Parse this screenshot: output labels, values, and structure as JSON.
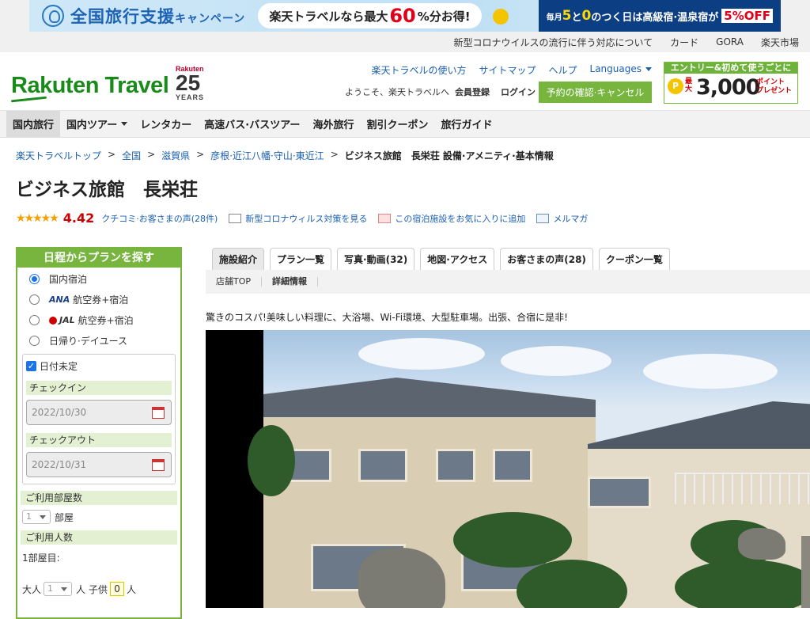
{
  "banner": {
    "title": "全国旅行支援",
    "title_suffix": "キャンペーン",
    "pill_prefix": "楽天トラベルなら最大",
    "pill_big": "60",
    "pill_suffix": "%分お得!",
    "right_prefix": "毎月",
    "right_5": "5",
    "right_mid": "と",
    "right_0": "0",
    "right_text": "のつく日は高級宿·温泉宿が",
    "right_pct": "5%OFF"
  },
  "top_links": [
    "新型コロナウイルスの流行に伴う対応について",
    "カード",
    "GORA",
    "楽天市場"
  ],
  "header": {
    "logo": "Rakuten Travel",
    "anniv_brand": "Rakuten",
    "anniv_num": "25",
    "anniv_years": "YEARS",
    "links": [
      "楽天トラベルの使い方",
      "サイトマップ",
      "ヘルプ"
    ],
    "languages": "Languages",
    "welcome": "ようこそ、楽天トラベルへ",
    "member": "会員登録",
    "login": "ログイン",
    "reserve": "予約の確認·キャンセル",
    "promo_top": "エントリー&初めて使うごとに",
    "promo_coin": "P",
    "promo_pre": "最大",
    "promo_amount": "3,000",
    "promo_pt1": "ポイント",
    "promo_pt2": "プレゼント"
  },
  "nav": [
    "国内旅行",
    "国内ツアー",
    "レンタカー",
    "高速バス·バスツアー",
    "海外旅行",
    "割引クーポン",
    "旅行ガイド"
  ],
  "breadcrumb": [
    "楽天トラベルトップ",
    "全国",
    "滋賀県",
    "彦根·近江八幡·守山·東近江"
  ],
  "breadcrumb_current": "ビジネス旅館　長栄荘 設備·アメニティ·基本情報",
  "hotel_title": "ビジネス旅館　長栄荘",
  "rating": {
    "stars": "★★★★★",
    "score": "4.42",
    "reviews": "クチコミ·お客さまの声(28件)",
    "covid": "新型コロナウィルス対策を見る",
    "favorite": "この宿泊施設をお気に入りに追加",
    "mail": "メルマガ"
  },
  "sidebar": {
    "title": "日程からプランを探す",
    "options": [
      {
        "label": "国内宿泊",
        "airline": ""
      },
      {
        "label": "航空券+宿泊",
        "airline": "ANA"
      },
      {
        "label": "航空券+宿泊",
        "airline": "JAL"
      },
      {
        "label": "日帰り·デイユース",
        "airline": ""
      }
    ],
    "date_undecided": "日付未定",
    "checkin_label": "チェックイン",
    "checkin_value": "2022/10/30",
    "checkout_label": "チェックアウト",
    "checkout_value": "2022/10/31",
    "rooms_label": "ご利用部屋数",
    "rooms_value": "1",
    "rooms_unit": "部屋",
    "guests_label": "ご利用人数",
    "room1": "1部屋目:",
    "adult_label": "大人",
    "adult_value": "1",
    "person": "人",
    "child_label": "子供",
    "child_value": "0",
    "person2": "人"
  },
  "tabs": [
    {
      "label": "施設紹介",
      "active": true
    },
    {
      "label": "プラン一覧",
      "active": false
    },
    {
      "label": "写真·動画(32)",
      "active": false
    },
    {
      "label": "地図·アクセス",
      "active": false
    },
    {
      "label": "お客さまの声(28)",
      "active": false
    },
    {
      "label": "クーポン一覧",
      "active": false
    }
  ],
  "subnav": [
    "店舗TOP",
    "詳細情報"
  ],
  "tagline": "驚きのコスパ!美味しい料理に、大浴場、Wi-Fi環境、大型駐車場。出張、合宿に是非!"
}
